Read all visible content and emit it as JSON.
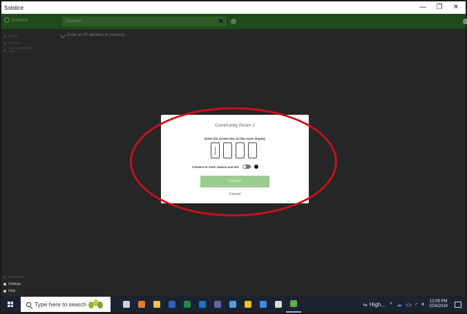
{
  "window": {
    "title": "Solstice",
    "minimize": "—",
    "maximize": "❐",
    "close": "✕"
  },
  "header": {
    "brand": "Solstice",
    "search_placeholder": "Discover",
    "clear_label": "✕"
  },
  "sidebar": {
    "top_items": [
      {
        "label": "Home",
        "icon": "home-icon"
      },
      {
        "label": "Recent",
        "icon": "clock-icon"
      },
      {
        "label": "Get Connected",
        "label2": "Help",
        "icon": "help-icon"
      }
    ],
    "bottom_items": [
      {
        "label": "Feedback",
        "icon": "feedback-icon"
      },
      {
        "label": "Settings",
        "icon": "gear-icon"
      },
      {
        "label": "Help",
        "icon": "question-icon"
      }
    ]
  },
  "main": {
    "ip_prompt": "Enter an IP address to connect..."
  },
  "modal": {
    "room_name": "Community Room 2",
    "instruction": "Enter the screen key on the room display",
    "key_slots": 4,
    "camera_label": "Connect to room camera and mic",
    "camera_enabled": false,
    "connect_label": "Connect",
    "cancel_label": "Cancel"
  },
  "colors": {
    "header_green": "#1f4a1a",
    "main_background": "#262626",
    "connect_button": "#9ccc8f",
    "annotation_red": "#c8101e",
    "taskbar": "#1c2230"
  },
  "taskbar": {
    "search_placeholder": "Type here to search",
    "apps": [
      {
        "name": "task-view-icon",
        "color": "#c9d3e3"
      },
      {
        "name": "firefox-icon",
        "color": "#e9782b"
      },
      {
        "name": "file-explorer-icon",
        "color": "#e9c34b"
      },
      {
        "name": "word-icon",
        "color": "#2b64c5"
      },
      {
        "name": "excel-icon",
        "color": "#1f8a4c"
      },
      {
        "name": "outlook-icon",
        "color": "#1c74c8"
      },
      {
        "name": "teams-icon",
        "color": "#6264a7"
      },
      {
        "name": "file-manager-icon",
        "color": "#4aa3df"
      },
      {
        "name": "sticky-notes-icon",
        "color": "#f0c419"
      },
      {
        "name": "zoom-icon",
        "color": "#3a8ee6"
      },
      {
        "name": "capcut-icon",
        "color": "#d9d9d9"
      },
      {
        "name": "solstice-icon",
        "color": "#5ab04a"
      }
    ],
    "network_label": "High...",
    "time": "12:09 PM",
    "date": "2/26/2024"
  }
}
